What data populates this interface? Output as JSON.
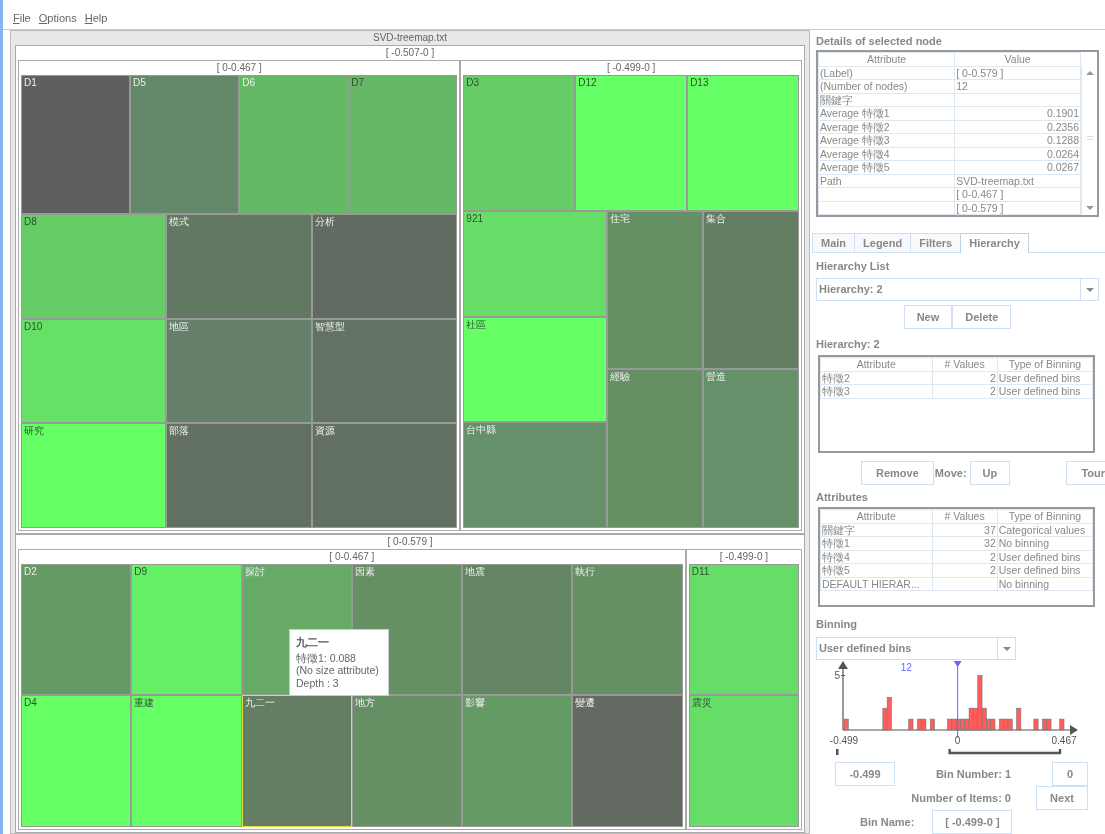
{
  "menu": [
    {
      "label": "File",
      "mnemonic": true
    },
    {
      "label": "Options",
      "mnemonic": true
    },
    {
      "label": "Help",
      "mnemonic": true
    }
  ],
  "treemap": {
    "root": {
      "label": "SVD-treemap.txt",
      "children": [
        {
          "label": "[ -0.507-0 ]",
          "children": [
            {
              "label": "[ 0-0.467 ]",
              "children": [
                {
                  "children": [
                    {
                      "name": "D1",
                      "color": "#5f5f5f",
                      "selected": false
                    },
                    {
                      "name": "D5",
                      "color": "#64896a",
                      "selected": false
                    },
                    {
                      "name": "D6",
                      "color": "#64b866",
                      "selected": false
                    },
                    {
                      "name": "D7",
                      "color": "#66b866",
                      "selected": false
                    }
                  ]
                },
                {
                  "children": [
                    {
                      "name": "D8",
                      "color": "#66cc66",
                      "selected": false
                    },
                    {
                      "name": "模式",
                      "color": "#637863",
                      "selected": false
                    },
                    {
                      "name": "分析",
                      "color": "#616b61",
                      "selected": false
                    }
                  ]
                },
                {
                  "children": [
                    {
                      "name": "D10",
                      "color": "#66e066",
                      "selected": false
                    },
                    {
                      "name": "地區",
                      "color": "#64806a",
                      "selected": false
                    },
                    {
                      "name": "智慧型",
                      "color": "#637363",
                      "selected": false
                    }
                  ]
                },
                {
                  "children": [
                    {
                      "name": "研究",
                      "color": "#66ff66",
                      "selected": false
                    },
                    {
                      "name": "部落",
                      "color": "#627062",
                      "selected": false
                    },
                    {
                      "name": "資源",
                      "color": "#627062",
                      "selected": false
                    }
                  ]
                }
              ]
            },
            {
              "label": "[ -0.499-0 ]",
              "children": [
                {
                  "children": [
                    {
                      "name": "D3",
                      "color": "#66cc66",
                      "selected": false
                    },
                    {
                      "name": "D12",
                      "color": "#66ff66",
                      "selected": false
                    },
                    {
                      "name": "D13",
                      "color": "#66ff66",
                      "selected": false
                    }
                  ]
                },
                {
                  "children": [
                    {
                      "children": [
                        {
                          "name": "921",
                          "color": "#66dd66",
                          "selected": false
                        },
                        {
                          "name": "社區",
                          "color": "#66ff66",
                          "selected": false
                        },
                        {
                          "name": "台中縣",
                          "color": "#64906a",
                          "selected": false
                        }
                      ]
                    },
                    {
                      "children": [
                        {
                          "children": [
                            {
                              "name": "住宅",
                              "color": "#649064",
                              "selected": false
                            },
                            {
                              "name": "集合",
                              "color": "#647e64",
                              "selected": false
                            }
                          ]
                        },
                        {
                          "children": [
                            {
                              "name": "經驗",
                              "color": "#649064",
                              "selected": false
                            },
                            {
                              "name": "營造",
                              "color": "#64906a",
                              "selected": false
                            }
                          ]
                        }
                      ]
                    }
                  ]
                }
              ]
            }
          ]
        },
        {
          "label": "[ 0-0.579 ]",
          "children": [
            {
              "label": "[ 0-0.467 ]",
              "children": [
                {
                  "children": [
                    {
                      "name": "D2",
                      "color": "#649a64",
                      "selected": false
                    },
                    {
                      "name": "D9",
                      "color": "#66f066",
                      "selected": false
                    },
                    {
                      "name": "探討",
                      "color": "#66aa66",
                      "selected": false
                    },
                    {
                      "name": "因素",
                      "color": "#649064",
                      "selected": false
                    },
                    {
                      "name": "地震",
                      "color": "#648564",
                      "selected": false
                    },
                    {
                      "name": "執行",
                      "color": "#649064",
                      "selected": false
                    }
                  ]
                },
                {
                  "children": [
                    {
                      "name": "D4",
                      "color": "#66ff66",
                      "selected": false
                    },
                    {
                      "name": "重建",
                      "color": "#66ff66",
                      "selected": false
                    },
                    {
                      "name": "九二一",
                      "color": "#647e64",
                      "selected": true
                    },
                    {
                      "name": "地方",
                      "color": "#649064",
                      "selected": false
                    },
                    {
                      "name": "影響",
                      "color": "#649a64",
                      "selected": false
                    },
                    {
                      "name": "變遷",
                      "color": "#626a62",
                      "selected": false
                    }
                  ]
                }
              ]
            },
            {
              "label": "[ -0.499-0 ]",
              "children": [
                {
                  "name": "D11",
                  "color": "#66dd66",
                  "selected": false
                },
                {
                  "name": "震災",
                  "color": "#66dd66",
                  "selected": false
                }
              ]
            }
          ]
        }
      ]
    }
  },
  "tooltip": {
    "title": "九二一",
    "lines": [
      "特徵1: 0.088",
      "(No size attribute)",
      "Depth : 3"
    ]
  },
  "details": {
    "title": "Details of selected node",
    "columns": [
      "Attribute",
      "Value"
    ],
    "rows": [
      {
        "attribute": "(Label)",
        "value": "[ 0-0.579 ]",
        "numeric": false
      },
      {
        "attribute": "(Number of nodes)",
        "value": "12",
        "numeric": false
      },
      {
        "attribute": "關鍵字"
      },
      {
        "attribute": "Average 特徵1",
        "value": "0.1901",
        "numeric": true
      },
      {
        "attribute": "Average 特徵2",
        "value": "0.2356",
        "numeric": true
      },
      {
        "attribute": "Average 特徵3",
        "value": "0.1288",
        "numeric": true
      },
      {
        "attribute": "Average 特徵4",
        "value": "0.0264",
        "numeric": true
      },
      {
        "attribute": "Average 特徵5",
        "value": "0.0267",
        "numeric": true
      },
      {
        "attribute": "Path",
        "value": "SVD-treemap.txt",
        "numeric": false
      },
      {
        "value": "[ 0-0.467 ]",
        "numeric": false
      },
      {
        "value": "[ 0-0.579 ]",
        "numeric": false
      }
    ]
  },
  "tabs": [
    {
      "label": "Main",
      "selected": false
    },
    {
      "label": "Legend",
      "selected": false
    },
    {
      "label": "Filters",
      "selected": false
    },
    {
      "label": "Hierarchy",
      "selected": true
    }
  ],
  "hierarchy": {
    "list_label": "Hierarchy List",
    "dropdown": "Hierarchy: 2",
    "buttons": [
      "New",
      "Delete"
    ],
    "table_label": "Hierarchy: 2",
    "columns": [
      "Attribute",
      "# Values",
      "Type of Binning"
    ],
    "rows": [
      {
        "attribute": "特徵2",
        "values": "2",
        "binning": "User defined bins"
      },
      {
        "attribute": "特徵3",
        "values": "2",
        "binning": "User defined bins"
      }
    ],
    "remove_button": "Remove",
    "move_label": "Move:",
    "up_button": "Up",
    "tour_button": "Tour"
  },
  "attributes": {
    "label": "Attributes",
    "columns": [
      "Attribute",
      "# Values",
      "Type of Binning"
    ],
    "rows": [
      {
        "attribute": "關鍵字",
        "values": "37",
        "binning": "Categorical values"
      },
      {
        "attribute": "特徵1",
        "values": "32",
        "binning": "No binning"
      },
      {
        "attribute": "特徵4",
        "values": "2",
        "binning": "User defined bins"
      },
      {
        "attribute": "特徵5",
        "values": "2",
        "binning": "User defined bins"
      },
      {
        "attribute": "DEFAULT HIERAR...",
        "binning": "No binning"
      }
    ]
  },
  "binning": {
    "label": "Binning",
    "dropdown": "User defined bins",
    "histogram": {
      "x_labels": [
        "-0.499",
        "0",
        "0.467"
      ],
      "y_label": "5",
      "marker_label": "12"
    },
    "bin_start": "-0.499",
    "bin_number": "Bin Number: 1",
    "bin_end": "0",
    "items": "Number of Items: 0",
    "next_button": "Next",
    "bin_name_label": "Bin Name:",
    "bin_name": "[ -0.499-0 ]"
  }
}
